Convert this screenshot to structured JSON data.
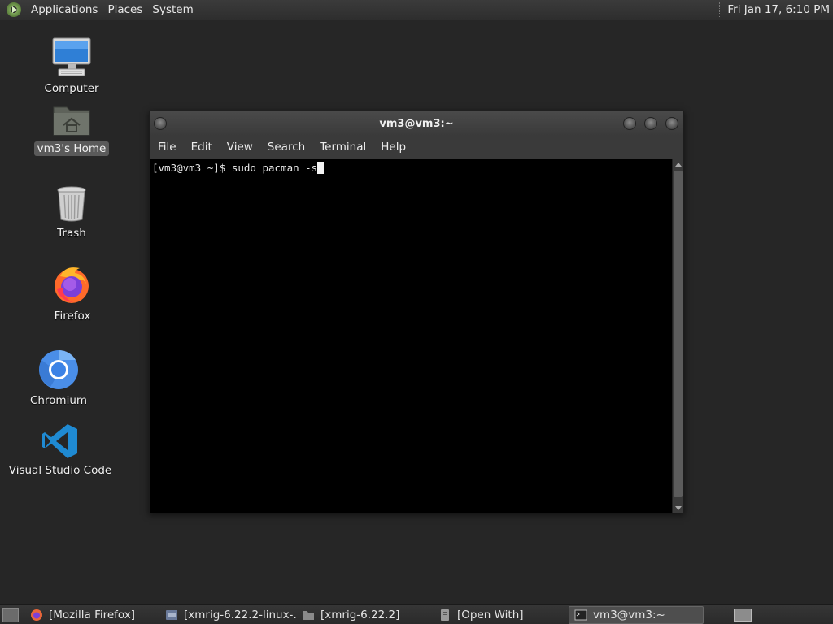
{
  "top_panel": {
    "menus": [
      "Applications",
      "Places",
      "System"
    ],
    "clock": "Fri Jan 17,  6:10 PM"
  },
  "desktop": {
    "icons": [
      {
        "label": "Computer",
        "icon": "computer-icon"
      },
      {
        "label": "vm3's Home",
        "icon": "home-folder-icon",
        "selected": true
      },
      {
        "label": "Trash",
        "icon": "trash-icon"
      },
      {
        "label": "Firefox",
        "icon": "firefox-icon"
      },
      {
        "label": "Chromium",
        "icon": "chromium-icon"
      },
      {
        "label": "Visual Studio Code",
        "icon": "vscode-icon"
      }
    ]
  },
  "terminal": {
    "title": "vm3@vm3:~",
    "menu": [
      "File",
      "Edit",
      "View",
      "Search",
      "Terminal",
      "Help"
    ],
    "prompt_line": "[vm3@vm3 ~]$ sudo pacman -s"
  },
  "taskbar": {
    "tasks": [
      {
        "label": "[Mozilla Firefox]",
        "icon": "firefox-icon"
      },
      {
        "label": "[xmrig-6.22.2-linux-…",
        "icon": "archive-icon"
      },
      {
        "label": "[xmrig-6.22.2]",
        "icon": "folder-icon"
      },
      {
        "label": "[Open With]",
        "icon": "dialog-icon"
      },
      {
        "label": "vm3@vm3:~",
        "icon": "terminal-icon",
        "active": true
      }
    ]
  },
  "colors": {
    "desktop_bg": "#262626",
    "panel_bg": "#333333",
    "terminal_bg": "#000000",
    "vscode_blue": "#1f8ad2",
    "chromium_blue": "#4a8ee8"
  }
}
